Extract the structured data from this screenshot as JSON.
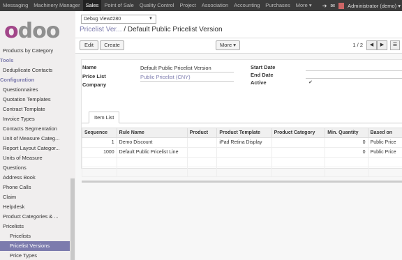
{
  "topbar": {
    "menu": [
      "Messaging",
      "Machinery Manager",
      "Sales",
      "Point of Sale",
      "Quality Control",
      "Project",
      "Association",
      "Accounting",
      "Purchases",
      "More ▾"
    ],
    "active_index": 2,
    "user": "Administrator (demo) ▾"
  },
  "logo": {
    "part1": "o",
    "part2": "doo"
  },
  "sidebar": {
    "items": [
      {
        "label": "Products by Category",
        "kind": "item"
      },
      {
        "label": "Tools",
        "kind": "section"
      },
      {
        "label": "Deduplicate Contacts",
        "kind": "item"
      },
      {
        "label": "Configuration",
        "kind": "section"
      },
      {
        "label": "Questionnaires",
        "kind": "item"
      },
      {
        "label": "Quotation Templates",
        "kind": "item"
      },
      {
        "label": "Contract Template",
        "kind": "item"
      },
      {
        "label": "Invoice Types",
        "kind": "item"
      },
      {
        "label": "Contacts Segmentation",
        "kind": "item"
      },
      {
        "label": "Unit of Measure Categ...",
        "kind": "item"
      },
      {
        "label": "Report Layout Categor...",
        "kind": "item"
      },
      {
        "label": "Units of Measure",
        "kind": "item"
      },
      {
        "label": "Questions",
        "kind": "item"
      },
      {
        "label": "Address Book",
        "kind": "item"
      },
      {
        "label": "Phone Calls",
        "kind": "item"
      },
      {
        "label": "Claim",
        "kind": "item"
      },
      {
        "label": "Helpdesk",
        "kind": "item"
      },
      {
        "label": "Product Categories & ...",
        "kind": "item"
      },
      {
        "label": "Pricelists",
        "kind": "item"
      },
      {
        "label": "Pricelists",
        "kind": "sub"
      },
      {
        "label": "Pricelist Versions",
        "kind": "selected"
      },
      {
        "label": "Price Types",
        "kind": "sub"
      }
    ]
  },
  "debug": {
    "label": "Debug View#280"
  },
  "breadcrumb": {
    "parent": "Pricelist Ver...",
    "sep": " / ",
    "current": "Default Public Pricelist Version"
  },
  "toolbar": {
    "edit": "Edit",
    "create": "Create",
    "more": "More ▾",
    "pager": "1 / 2"
  },
  "form": {
    "name_label": "Name",
    "name_value": "Default Public Pricelist Version",
    "pricelist_label": "Price List",
    "pricelist_value": "Public Pricelist (CNY)",
    "company_label": "Company",
    "start_label": "Start Date",
    "end_label": "End Date",
    "active_label": "Active",
    "active_value": "✔"
  },
  "tab": {
    "label": "Item List"
  },
  "items_table": {
    "headers": [
      "Sequence",
      "Rule Name",
      "Product",
      "Product Template",
      "Product Category",
      "Min. Quantity",
      "Based on"
    ],
    "rows": [
      [
        "1",
        "Demo Discount",
        "",
        "iPad Retina Display",
        "",
        "0",
        "Public Price"
      ],
      [
        "1000",
        "Default Public Pricelist Line",
        "",
        "",
        "",
        "0",
        "Public Price"
      ]
    ]
  }
}
